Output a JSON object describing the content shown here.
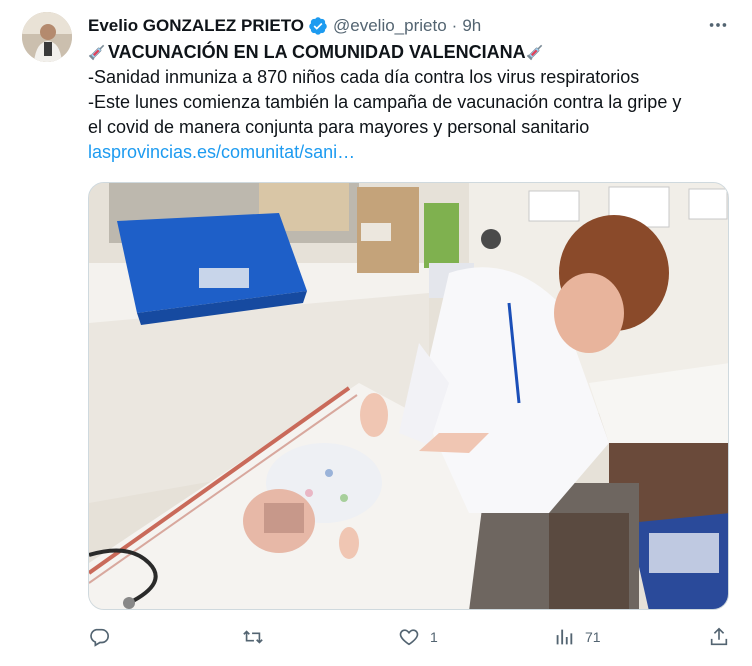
{
  "tweet": {
    "author_name": "Evelio GONZALEZ PRIETO",
    "handle": "@evelio_prieto",
    "separator": "·",
    "time": "9h",
    "title": "VACUNACIÓN EN LA COMUNIDAD VALENCIANA",
    "line1": "-Sanidad inmuniza a 870 niños cada día contra los virus respiratorios",
    "line2": "-Este lunes comienza también la campaña de vacunación contra la gripe y",
    "line3": "el covid de manera conjunta para mayores y personal sanitario",
    "link": "lasprovincias.es/comunitat/sani…",
    "image_icon_name": "vaccination-photo",
    "verified_color": "#1d9bf0"
  },
  "actions": {
    "reply_icon": "reply-icon",
    "retweet_icon": "retweet-icon",
    "like_icon": "heart-icon",
    "like_count": "1",
    "views_icon": "views-icon",
    "views_count": "71",
    "share_icon": "share-icon"
  }
}
